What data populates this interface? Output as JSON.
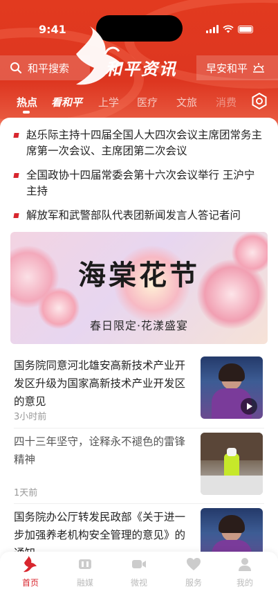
{
  "status": {
    "time": "9:41"
  },
  "header": {
    "search_label": "和平搜索",
    "brand": "和平资讯",
    "greeting": "早安和平",
    "tabs": [
      {
        "label": "热点",
        "state": "active"
      },
      {
        "label": "看和平",
        "state": "emphasis"
      },
      {
        "label": "上学"
      },
      {
        "label": "医疗"
      },
      {
        "label": "文旅"
      },
      {
        "label": "消费"
      }
    ]
  },
  "headlines": [
    "赵乐际主持十四届全国人大四次会议主席团常务主席第一次会议、主席团第二次会议",
    "全国政协十四届常委会第十六次会议举行 王沪宁主持",
    "解放军和武警部队代表团新闻发言人答记者问"
  ],
  "banner": {
    "title": "海棠花节",
    "subtitle": "春日限定·花漾盛宴"
  },
  "news": [
    {
      "title": "国务院同意河北雄安高新技术产业开发区升级为国家高新技术产业开发区的意见",
      "meta": "3小时前",
      "has_video": true
    },
    {
      "title": "四十三年坚守，诠释永不褪色的雷锋精神",
      "meta": "1天前",
      "has_video": false
    },
    {
      "title": "国务院办公厅转发民政部《关于进一步加强养老机构安全管理的意见》的通知",
      "meta": "",
      "has_video": false
    }
  ],
  "tabbar": [
    {
      "label": "首页",
      "icon": "bird-logo-icon",
      "active": true
    },
    {
      "label": "融媒",
      "icon": "media-icon",
      "active": false
    },
    {
      "label": "微视",
      "icon": "video-camera-icon",
      "active": false
    },
    {
      "label": "服务",
      "icon": "heart-icon",
      "active": false
    },
    {
      "label": "我的",
      "icon": "person-icon",
      "active": false
    }
  ],
  "colors": {
    "brand_red": "#e23a1f",
    "accent_red": "#d8262e"
  }
}
